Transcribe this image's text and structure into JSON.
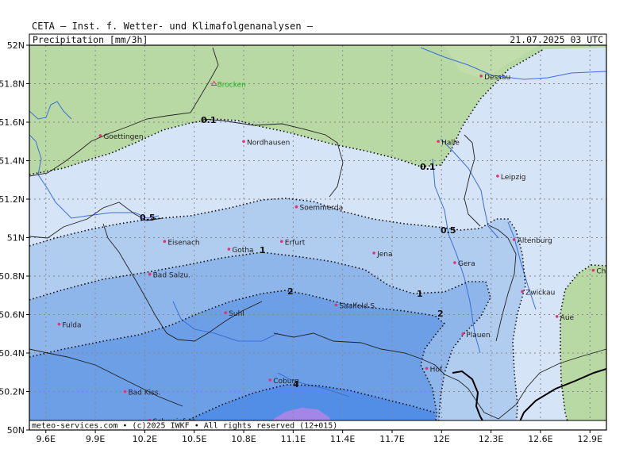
{
  "header": {
    "title": "CETA — Inst. f. Wetter- und Klimafolgenanalysen —",
    "product": "Precipitation [mm/3h]",
    "datetime": "21.07.2025 03 UTC"
  },
  "footer": {
    "credit": "meteo-services.com • (c)2025 IWKF • All rights reserved (12+015)"
  },
  "axes": {
    "lat_labels": [
      "52N",
      "51.8N",
      "51.6N",
      "51.4N",
      "51.2N",
      "51N",
      "50.8N",
      "50.6N",
      "50.4N",
      "50.2N",
      "50N"
    ],
    "lon_labels": [
      "9.6E",
      "9.9E",
      "10.2E",
      "10.5E",
      "10.8E",
      "11.1E",
      "11.4E",
      "11.7E",
      "12E",
      "12.3E",
      "12.6E",
      "12.9E"
    ]
  },
  "contours": {
    "c01": "0.1",
    "c05": "0.5",
    "c1": "1",
    "c2": "2",
    "c4": "4"
  },
  "colors": {
    "green": "#b9d9a4",
    "lightblue": "#d5e4f7",
    "blue2": "#b0ccef",
    "blue3": "#8fb6ea",
    "blue4": "#6d9fe6",
    "blue5": "#538ee6",
    "purple": "#a486e6",
    "city": "#e8307a",
    "brocken": "#22aa22"
  },
  "cities": [
    {
      "name": "Brocken",
      "lat": 51.8,
      "lon": 10.62
    },
    {
      "name": "Goettingen",
      "lat": 51.53,
      "lon": 9.93
    },
    {
      "name": "Nordhausen",
      "lat": 51.5,
      "lon": 10.8
    },
    {
      "name": "Dessau",
      "lat": 51.84,
      "lon": 12.24
    },
    {
      "name": "Halle",
      "lat": 51.5,
      "lon": 11.98
    },
    {
      "name": "Leipzig",
      "lat": 51.32,
      "lon": 12.34
    },
    {
      "name": "Soemmerda",
      "lat": 51.16,
      "lon": 11.12
    },
    {
      "name": "Eisenach",
      "lat": 50.98,
      "lon": 10.32
    },
    {
      "name": "Gotha",
      "lat": 50.94,
      "lon": 10.71
    },
    {
      "name": "Erfurt",
      "lat": 50.98,
      "lon": 11.03
    },
    {
      "name": "Jena",
      "lat": 50.92,
      "lon": 11.59
    },
    {
      "name": "Gera",
      "lat": 50.87,
      "lon": 12.08
    },
    {
      "name": "Altenburg",
      "lat": 50.99,
      "lon": 12.44
    },
    {
      "name": "Chemnitz",
      "lat": 50.83,
      "lon": 12.92
    },
    {
      "name": "Bad Salzu.",
      "lat": 50.81,
      "lon": 10.23
    },
    {
      "name": "Saalfeld S.",
      "lat": 50.65,
      "lon": 11.36
    },
    {
      "name": "Zwickau",
      "lat": 50.72,
      "lon": 12.49
    },
    {
      "name": "Suhl",
      "lat": 50.61,
      "lon": 10.69
    },
    {
      "name": "Fulda",
      "lat": 50.55,
      "lon": 9.68
    },
    {
      "name": "Aue",
      "lat": 50.59,
      "lon": 12.7
    },
    {
      "name": "Plauen",
      "lat": 50.5,
      "lon": 12.13
    },
    {
      "name": "Hof",
      "lat": 50.32,
      "lon": 11.91
    },
    {
      "name": "Coburg",
      "lat": 50.26,
      "lon": 10.96
    },
    {
      "name": "Bad Kiss.",
      "lat": 50.2,
      "lon": 10.08
    },
    {
      "name": "Schweinfurt",
      "lat": 50.05,
      "lon": 10.23
    }
  ]
}
